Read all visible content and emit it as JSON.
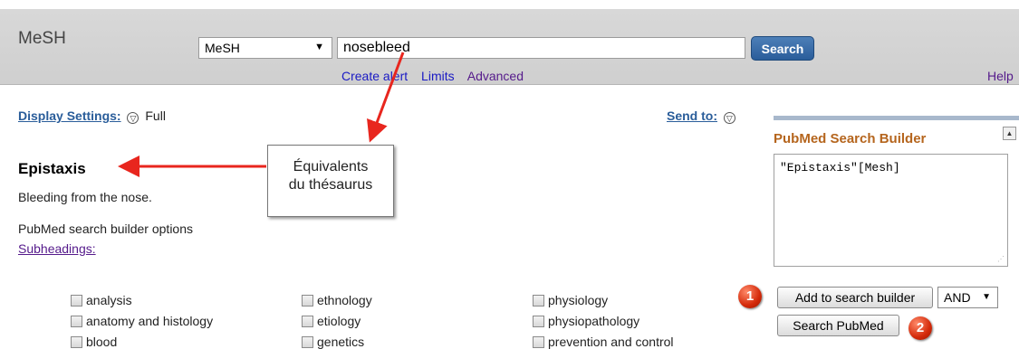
{
  "header": {
    "app_title": "MeSH",
    "database_select": "MeSH",
    "search_value": "nosebleed",
    "search_button": "Search",
    "links": {
      "create_alert": "Create alert",
      "limits": "Limits",
      "advanced": "Advanced"
    },
    "help": "Help"
  },
  "display_settings": {
    "label": "Display Settings:",
    "value": "Full"
  },
  "send_to": {
    "label": "Send to:"
  },
  "record": {
    "title": "Epistaxis",
    "description": "Bleeding from the nose.",
    "options_heading": "PubMed search builder options",
    "subheadings_link": "Subheadings:"
  },
  "callout": {
    "line1": "Équivalents",
    "line2": "du thésaurus"
  },
  "subheadings": [
    "analysis",
    "anatomy and histology",
    "blood",
    "ethnology",
    "etiology",
    "genetics",
    "physiology",
    "physiopathology",
    "prevention and control"
  ],
  "builder": {
    "title": "PubMed Search Builder",
    "query": "\"Epistaxis\"[Mesh]",
    "add_button": "Add to search builder",
    "operator": "AND",
    "search_pubmed_button": "Search PubMed"
  },
  "markers": {
    "first": "1",
    "second": "2"
  },
  "colors": {
    "accent_blue": "#2a5d9a",
    "builder_title": "#b5651d",
    "arrow_red": "#e8261e"
  }
}
